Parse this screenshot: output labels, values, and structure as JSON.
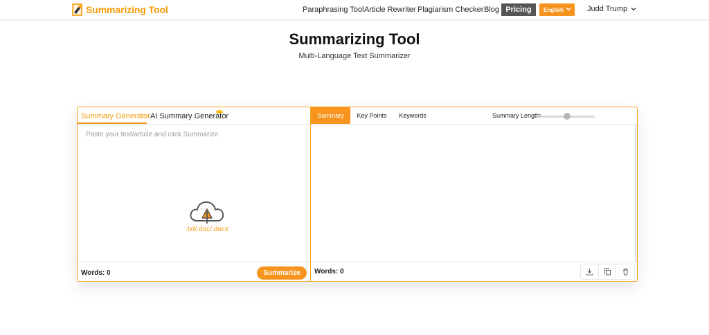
{
  "brand": {
    "name": "Summarizing Tool"
  },
  "nav": {
    "links": [
      "Paraphrasing Tool",
      "Article Rewriter",
      "Plagiarism Checker",
      "Blog"
    ],
    "pricing_label": "Pricing",
    "language_label": "English",
    "user_name": "Judd Trump"
  },
  "header": {
    "title": "Summarizing Tool",
    "subtitle": "Multi-Language Text Summarizer"
  },
  "input_panel": {
    "tabs": [
      "Summary Generator",
      "AI Summary Generator"
    ],
    "active_tab": "Summary Generator",
    "placeholder": "Paste your text/article and click Summarize",
    "upload_formats": ".txt/.doc/.docx",
    "words_label": "Words: 0",
    "summarize_label": "Summarize"
  },
  "output_panel": {
    "tabs": [
      "Summary",
      "Key Points",
      "Keywords"
    ],
    "active_tab": "Summary",
    "summary_length_label": "Summary Length:",
    "summary_length_level": 0.5,
    "words_label": "Words: 0",
    "actions": [
      "download-icon",
      "copy-icon",
      "delete-icon"
    ]
  },
  "colors": {
    "accent": "#f7941d",
    "pricing_bg": "#555555",
    "border": "#f7a21b"
  }
}
